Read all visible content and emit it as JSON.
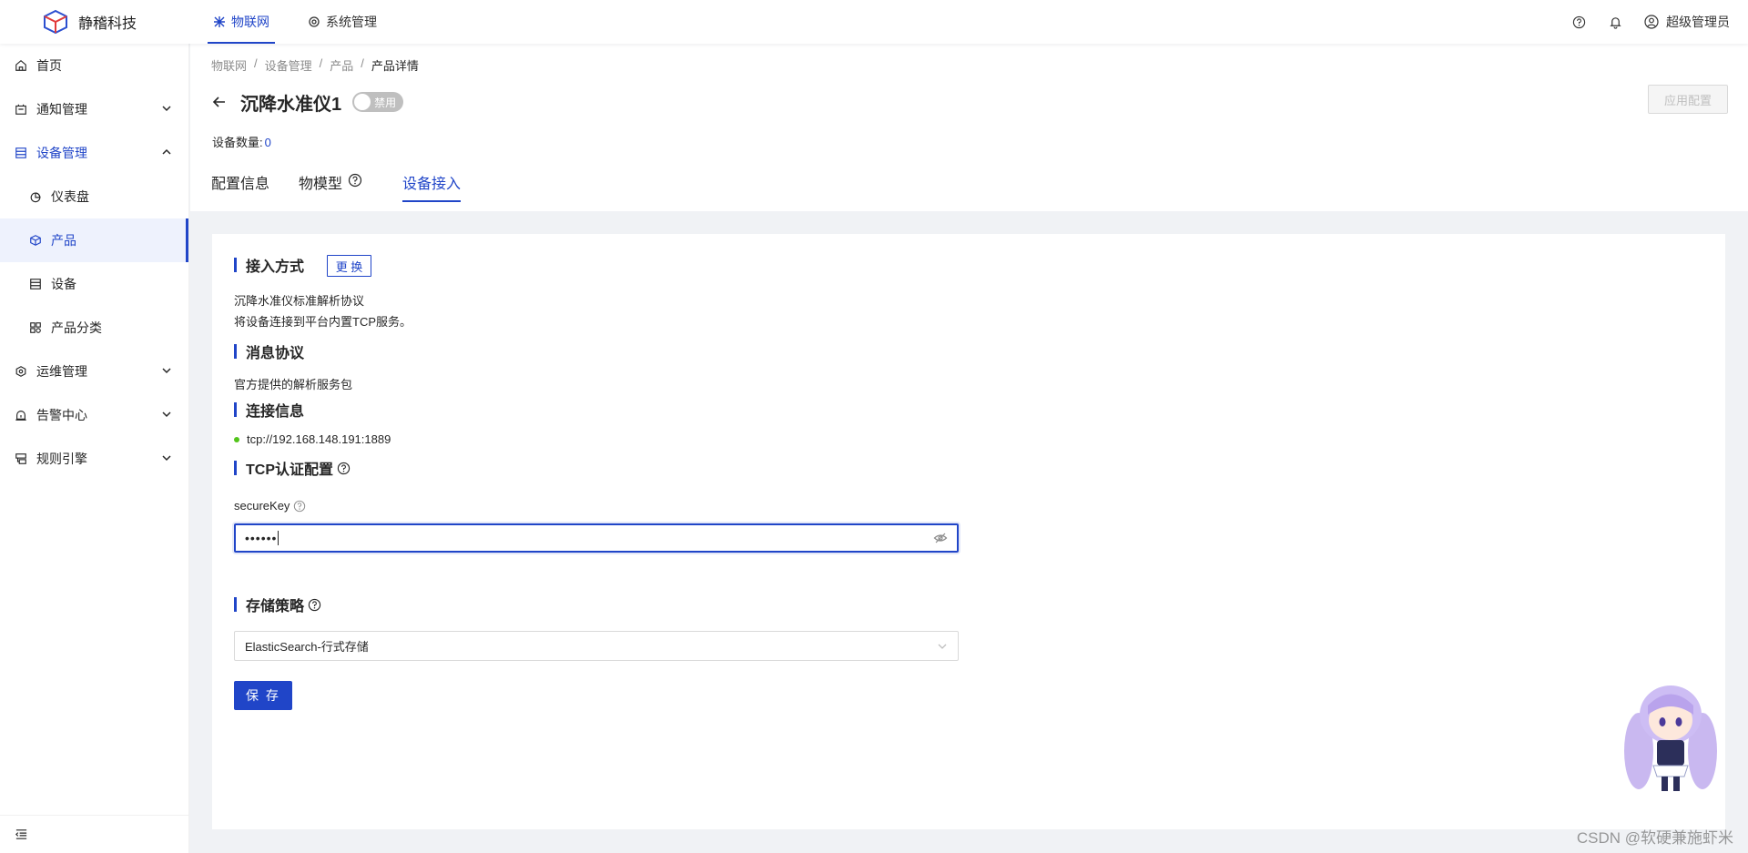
{
  "brand": {
    "name": "静稽科技"
  },
  "topnav": {
    "items": [
      {
        "label": "物联网",
        "icon": "iot-icon",
        "active": true
      },
      {
        "label": "系统管理",
        "icon": "settings-icon",
        "active": false
      }
    ],
    "user": "超级管理员"
  },
  "sidebar": {
    "items": [
      {
        "label": "首页",
        "icon": "home-icon"
      },
      {
        "label": "通知管理",
        "icon": "notice-icon"
      },
      {
        "label": "设备管理",
        "icon": "device-icon",
        "open": true
      },
      {
        "label": "仪表盘",
        "icon": "dashboard-icon"
      },
      {
        "label": "产品",
        "icon": "product-icon",
        "selected": true
      },
      {
        "label": "设备",
        "icon": "device-list-icon"
      },
      {
        "label": "产品分类",
        "icon": "category-icon"
      },
      {
        "label": "运维管理",
        "icon": "ops-icon"
      },
      {
        "label": "告警中心",
        "icon": "alarm-icon"
      },
      {
        "label": "规则引擎",
        "icon": "rule-icon"
      }
    ]
  },
  "breadcrumb": [
    "物联网",
    "设备管理",
    "产品",
    "产品详情"
  ],
  "product": {
    "title": "沉降水准仪1",
    "status_label": "禁用",
    "device_count_label": "设备数量:",
    "device_count": "0",
    "apply_label": "应用配置"
  },
  "tabs": [
    {
      "label": "配置信息"
    },
    {
      "label": "物模型"
    },
    {
      "label": "设备接入",
      "active": true
    }
  ],
  "access": {
    "method_title": "接入方式",
    "change_label": "更 换",
    "protocol_name": "沉降水准仪标准解析协议",
    "protocol_desc": "将设备连接到平台内置TCP服务。",
    "message_title": "消息协议",
    "message_desc": "官方提供的解析服务包",
    "conn_title": "连接信息",
    "conn_address": "tcp://192.168.148.191:1889",
    "tcp_title": "TCP认证配置",
    "secure_key_label": "secureKey",
    "secure_key_value": "••••••",
    "storage_title": "存储策略",
    "storage_value": "ElasticSearch-行式存储",
    "save_label": "保 存"
  },
  "watermark": "CSDN @软硬兼施虾米",
  "colors": {
    "primary": "#2045c8",
    "success": "#52c41a"
  }
}
